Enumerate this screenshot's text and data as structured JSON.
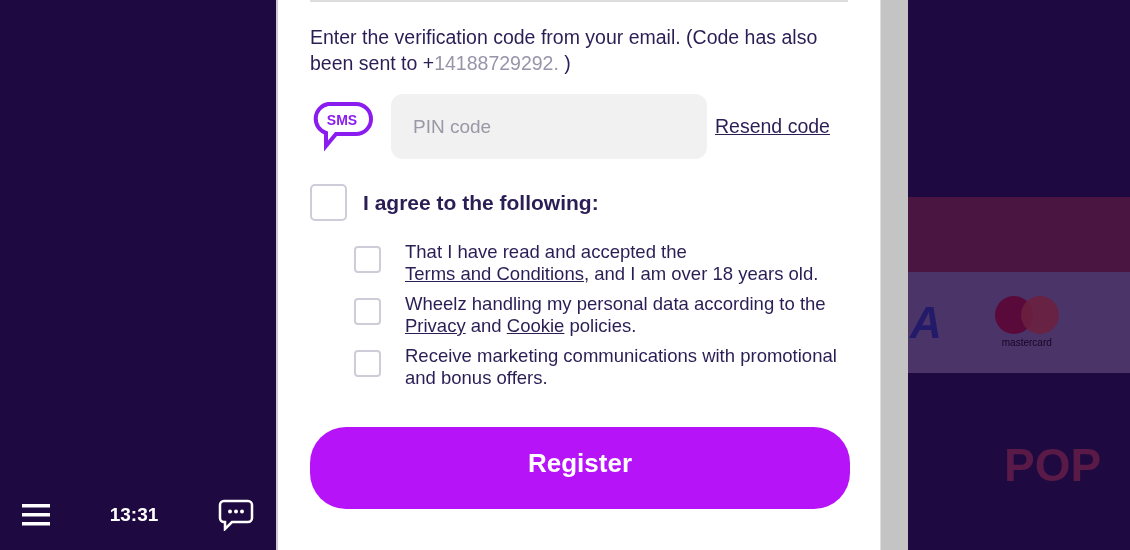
{
  "sidebar": {
    "time": "13:31"
  },
  "form": {
    "intro": "Enter the verification code from your email. (Code has also been sent to +",
    "phone": "14188729292.",
    "intro_end": " )",
    "pin": {
      "badge": "SMS",
      "placeholder": "PIN code",
      "resend": "Resend code"
    },
    "agree_all": {
      "label": "I agree to the following:",
      "checked": false
    },
    "consents": [
      {
        "checked": false,
        "parts": [
          {
            "text": "That I have read and accepted the "
          },
          {
            "text": "Terms and Conditions",
            "kind": "link"
          },
          {
            "text": ", and I am over 18 years old."
          }
        ]
      },
      {
        "checked": false,
        "parts": [
          {
            "text": "Wheelz handling my personal data according to the "
          },
          {
            "text": "Privacy",
            "kind": "link"
          },
          {
            "text": " and "
          },
          {
            "text": "Cookie",
            "kind": "link"
          },
          {
            "text": " policies."
          }
        ]
      },
      {
        "checked": false,
        "parts": [
          {
            "text": "Receive marketing communications with promotional and bonus offers."
          }
        ]
      }
    ],
    "submit": "Register"
  },
  "background": {
    "card_brand": "A",
    "card_brand_2": "mastercard",
    "promo": "POP"
  }
}
